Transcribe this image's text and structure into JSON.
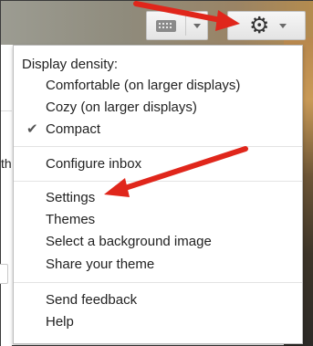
{
  "toolbar": {
    "keyboard_button": {
      "icon": "keyboard-icon",
      "dropdown": "chevron-down-icon"
    },
    "settings_button": {
      "icon": "gear-icon",
      "glyph": "⚙",
      "dropdown": "chevron-down-icon"
    }
  },
  "background": {
    "partial_text": "th"
  },
  "menu": {
    "display_density_heading": "Display density:",
    "density_options": [
      {
        "label": "Comfortable (on larger displays)",
        "selected": false
      },
      {
        "label": "Cozy (on larger displays)",
        "selected": false
      },
      {
        "label": "Compact",
        "selected": true
      }
    ],
    "check_glyph": "✔",
    "configure_inbox": "Configure inbox",
    "settings_items": [
      "Settings",
      "Themes",
      "Select a background image",
      "Share your theme"
    ],
    "support_items": [
      "Send feedback",
      "Help"
    ]
  },
  "annotations": {
    "arrow_color": "#e0261b"
  }
}
